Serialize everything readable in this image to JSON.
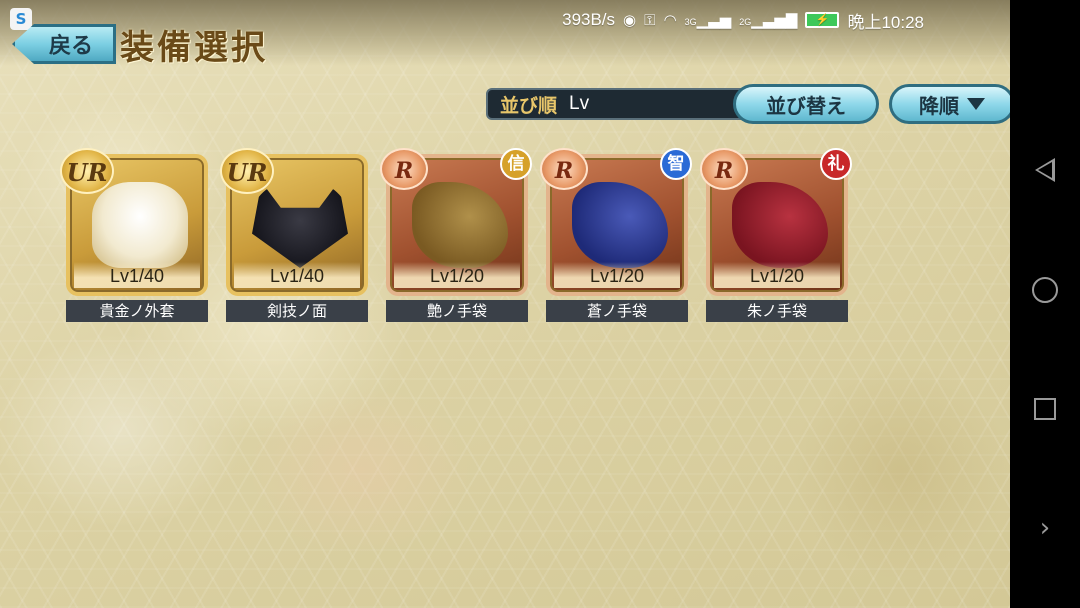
{
  "status_bar": {
    "net_speed": "393B/s",
    "net_3g": "3G",
    "net_2g": "2G",
    "time": "晩上10:28"
  },
  "header": {
    "back_label": "戻る",
    "title": "装備選択"
  },
  "sort": {
    "label": "並び順",
    "value": "Lv",
    "sort_button": "並び替え",
    "order_button": "降順"
  },
  "items": [
    {
      "rank": "UR",
      "level": "Lv1/40",
      "name": "貴金ノ外套",
      "attr": "",
      "color": "#f4f0e0"
    },
    {
      "rank": "UR",
      "level": "Lv1/40",
      "name": "剣技ノ面",
      "attr": "",
      "color": "#1c1c24"
    },
    {
      "rank": "R",
      "level": "Lv1/20",
      "name": "艶ノ手袋",
      "attr": "信",
      "attr_color": "#d6a12a",
      "color": "#8a6a2a"
    },
    {
      "rank": "R",
      "level": "Lv1/20",
      "name": "蒼ノ手袋",
      "attr": "智",
      "attr_color": "#2a6ad6",
      "color": "#2a3a8c"
    },
    {
      "rank": "R",
      "level": "Lv1/20",
      "name": "朱ノ手袋",
      "attr": "礼",
      "attr_color": "#c8282a",
      "color": "#8c1c24"
    }
  ],
  "nav": {
    "more": "›"
  }
}
